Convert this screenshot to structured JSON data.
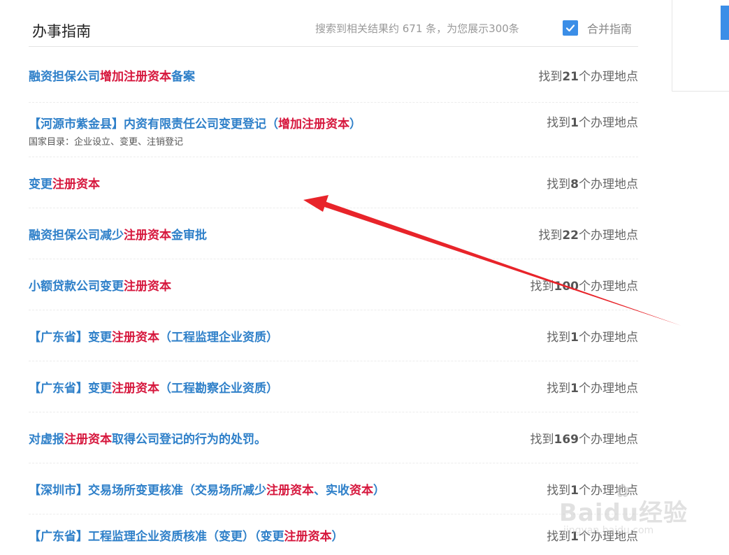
{
  "header": {
    "title": "办事指南",
    "summary": "搜索到相关结果约 671 条，为您展示300条",
    "merge_label": "合并指南",
    "merge_checked": true
  },
  "colors": {
    "link": "#2f80c9",
    "highlight": "#d6173d",
    "accent": "#3b8ee7",
    "arrow": "#e8242a"
  },
  "results": [
    {
      "title_parts": [
        {
          "t": "融资担保公司",
          "hl": false
        },
        {
          "t": "增加注册资本",
          "hl": true
        },
        {
          "t": "备案",
          "hl": false
        }
      ],
      "subtitle": "",
      "count_prefix": "找到",
      "count": "21",
      "count_suffix": "个办理地点"
    },
    {
      "title_parts": [
        {
          "t": "【河源市紫金县】内资有限责任公司变更登记（",
          "hl": false
        },
        {
          "t": "增加注册资本",
          "hl": true
        },
        {
          "t": "）",
          "hl": false
        }
      ],
      "subtitle": "国家目录：企业设立、变更、注销登记",
      "count_prefix": "找到",
      "count": "1",
      "count_suffix": "个办理地点"
    },
    {
      "title_parts": [
        {
          "t": "变更",
          "hl": false
        },
        {
          "t": "注册资本",
          "hl": true
        }
      ],
      "subtitle": "",
      "count_prefix": "找到",
      "count": "8",
      "count_suffix": "个办理地点"
    },
    {
      "title_parts": [
        {
          "t": "融资担保公司减少",
          "hl": false
        },
        {
          "t": "注册资本",
          "hl": true
        },
        {
          "t": "金审批",
          "hl": false
        }
      ],
      "subtitle": "",
      "count_prefix": "找到",
      "count": "22",
      "count_suffix": "个办理地点"
    },
    {
      "title_parts": [
        {
          "t": "小额贷款公司变更",
          "hl": false
        },
        {
          "t": "注册资本",
          "hl": true
        }
      ],
      "subtitle": "",
      "count_prefix": "找到",
      "count": "100",
      "count_suffix": "个办理地点"
    },
    {
      "title_parts": [
        {
          "t": "【广东省】变更",
          "hl": false
        },
        {
          "t": "注册资本",
          "hl": true
        },
        {
          "t": "（工程监理企业资质）",
          "hl": false
        }
      ],
      "subtitle": "",
      "count_prefix": "找到",
      "count": "1",
      "count_suffix": "个办理地点"
    },
    {
      "title_parts": [
        {
          "t": "【广东省】变更",
          "hl": false
        },
        {
          "t": "注册资本",
          "hl": true
        },
        {
          "t": "（工程勘察企业资质）",
          "hl": false
        }
      ],
      "subtitle": "",
      "count_prefix": "找到",
      "count": "1",
      "count_suffix": "个办理地点"
    },
    {
      "title_parts": [
        {
          "t": "对虚报",
          "hl": false
        },
        {
          "t": "注册资本",
          "hl": true
        },
        {
          "t": "取得公司登记的行为的处罚。",
          "hl": false
        }
      ],
      "subtitle": "",
      "count_prefix": "找到",
      "count": "169",
      "count_suffix": "个办理地点"
    },
    {
      "title_parts": [
        {
          "t": "【深圳市】交易场所变更核准（交易场所减少",
          "hl": false
        },
        {
          "t": "注册资本",
          "hl": true
        },
        {
          "t": "、实收",
          "hl": false
        },
        {
          "t": "资本",
          "hl": true
        },
        {
          "t": "）",
          "hl": false
        }
      ],
      "subtitle": "",
      "count_prefix": "找到",
      "count": "1",
      "count_suffix": "个办理地点"
    },
    {
      "title_parts": [
        {
          "t": "【广东省】工程监理企业资质核准（变更）（变更",
          "hl": false
        },
        {
          "t": "注册资本",
          "hl": true
        },
        {
          "t": "）",
          "hl": false
        }
      ],
      "subtitle": "",
      "count_prefix": "找到",
      "count": "1",
      "count_suffix": "个办理地点"
    }
  ],
  "watermark": {
    "main": "Baidu经验",
    "sub": "jingyan.baidu.com"
  }
}
